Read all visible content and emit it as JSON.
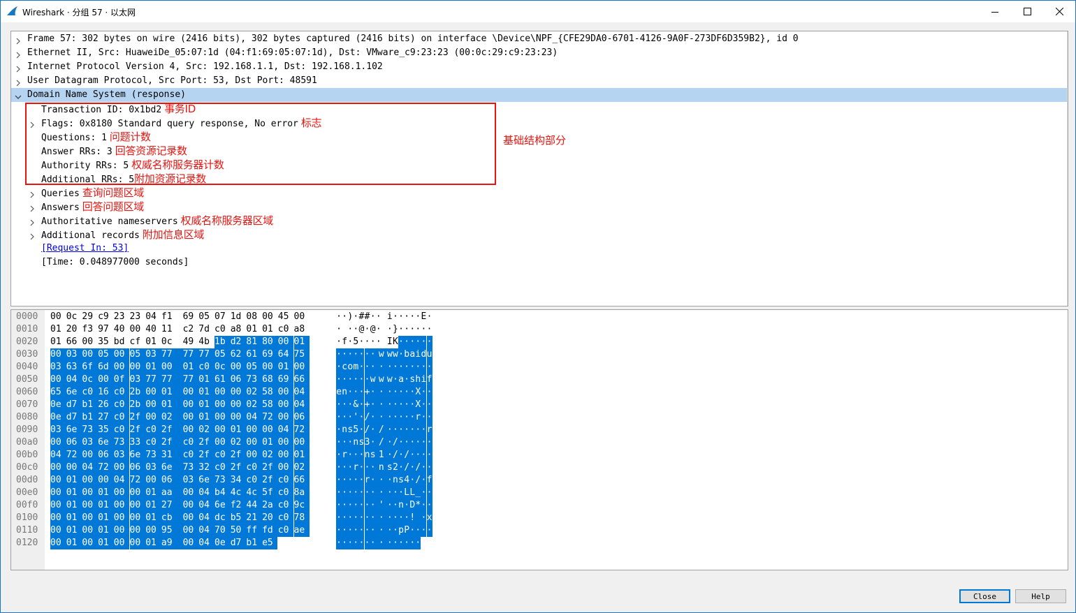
{
  "window": {
    "title": "Wireshark · 分组 57 · 以太网",
    "icons": {
      "app": "wireshark-fin-icon",
      "minimize": "minimize-icon",
      "maximize": "maximize-icon",
      "close": "close-icon"
    }
  },
  "tree": {
    "frame": "Frame 57: 302 bytes on wire (2416 bits), 302 bytes captured (2416 bits) on interface \\Device\\NPF_{CFE29DA0-6701-4126-9A0F-273DF6D359B2}, id 0",
    "ethernet": "Ethernet II, Src: HuaweiDe_05:07:1d (04:f1:69:05:07:1d), Dst: VMware_c9:23:23 (00:0c:29:c9:23:23)",
    "ip": "Internet Protocol Version 4, Src: 192.168.1.1, Dst: 192.168.1.102",
    "udp": "User Datagram Protocol, Src Port: 53, Dst Port: 48591",
    "dns": "Domain Name System (response)",
    "transaction_id": "Transaction ID: 0x1bd2",
    "transaction_id_note": "事务ID",
    "flags": "Flags: 0x8180 Standard query response, No error",
    "flags_note": "标志",
    "questions": "Questions: 1",
    "questions_note": "问题计数",
    "answer_rrs": "Answer RRs: 3",
    "answer_rrs_note": "回答资源记录数",
    "authority_rrs": "Authority RRs: 5",
    "authority_rrs_note": "权威名称服务器计数",
    "additional_rrs": "Additional RRs: 5",
    "additional_rrs_note": "附加资源记录数",
    "queries": "Queries",
    "queries_note": "查询问题区域",
    "answers": "Answers",
    "answers_note": "回答问题区域",
    "authoritative": "Authoritative nameservers",
    "authoritative_note": "权威名称服务器区域",
    "additional": "Additional records",
    "additional_note": "附加信息区域",
    "request_in": "[Request In: 53]",
    "time": "[Time: 0.048977000 seconds]",
    "side_note": "基础结构部分"
  },
  "hex_dump": {
    "selection_start_byte": 42,
    "rows": [
      {
        "offset": "0000",
        "bytes": [
          "00",
          "0c",
          "29",
          "c9",
          "23",
          "23",
          "04",
          "f1",
          "69",
          "05",
          "07",
          "1d",
          "08",
          "00",
          "45",
          "00"
        ],
        "ascii": [
          "·",
          "·",
          ")",
          "·",
          "#",
          "#",
          "·",
          "·",
          "i",
          "·",
          "·",
          "·",
          "·",
          "·",
          "E",
          "·"
        ]
      },
      {
        "offset": "0010",
        "bytes": [
          "01",
          "20",
          "f3",
          "97",
          "40",
          "00",
          "40",
          "11",
          "c2",
          "7d",
          "c0",
          "a8",
          "01",
          "01",
          "c0",
          "a8"
        ],
        "ascii": [
          "·",
          " ",
          "·",
          "·",
          "@",
          "·",
          "@",
          "·",
          "·",
          "}",
          "·",
          "·",
          "·",
          "·",
          "·",
          "·"
        ]
      },
      {
        "offset": "0020",
        "bytes": [
          "01",
          "66",
          "00",
          "35",
          "bd",
          "cf",
          "01",
          "0c",
          "49",
          "4b",
          "1b",
          "d2",
          "81",
          "80",
          "00",
          "01"
        ],
        "ascii": [
          "·",
          "f",
          "·",
          "5",
          "·",
          "·",
          "·",
          "·",
          "I",
          "K",
          "·",
          "·",
          "·",
          "·",
          "·",
          "·"
        ]
      },
      {
        "offset": "0030",
        "bytes": [
          "00",
          "03",
          "00",
          "05",
          "00",
          "05",
          "03",
          "77",
          "77",
          "77",
          "05",
          "62",
          "61",
          "69",
          "64",
          "75"
        ],
        "ascii": [
          "·",
          "·",
          "·",
          "·",
          "·",
          "·",
          "·",
          "w",
          "w",
          "w",
          "·",
          "b",
          "a",
          "i",
          "d",
          "u"
        ]
      },
      {
        "offset": "0040",
        "bytes": [
          "03",
          "63",
          "6f",
          "6d",
          "00",
          "00",
          "01",
          "00",
          "01",
          "c0",
          "0c",
          "00",
          "05",
          "00",
          "01",
          "00"
        ],
        "ascii": [
          "·",
          "c",
          "o",
          "m",
          "·",
          "·",
          "·",
          "·",
          "·",
          "·",
          "·",
          "·",
          "·",
          "·",
          "·",
          "·"
        ]
      },
      {
        "offset": "0050",
        "bytes": [
          "00",
          "04",
          "0c",
          "00",
          "0f",
          "03",
          "77",
          "77",
          "77",
          "01",
          "61",
          "06",
          "73",
          "68",
          "69",
          "66"
        ],
        "ascii": [
          "·",
          "·",
          "·",
          "·",
          "·",
          "·",
          "w",
          "w",
          "w",
          "·",
          "a",
          "·",
          "s",
          "h",
          "i",
          "f"
        ]
      },
      {
        "offset": "0060",
        "bytes": [
          "65",
          "6e",
          "c0",
          "16",
          "c0",
          "2b",
          "00",
          "01",
          "00",
          "01",
          "00",
          "00",
          "02",
          "58",
          "00",
          "04"
        ],
        "ascii": [
          "e",
          "n",
          "·",
          "·",
          "·",
          "+",
          "·",
          "·",
          "·",
          "·",
          "·",
          "·",
          "·",
          "X",
          "·",
          "·"
        ]
      },
      {
        "offset": "0070",
        "bytes": [
          "0e",
          "d7",
          "b1",
          "26",
          "c0",
          "2b",
          "00",
          "01",
          "00",
          "01",
          "00",
          "00",
          "02",
          "58",
          "00",
          "04"
        ],
        "ascii": [
          "·",
          "·",
          "·",
          "&",
          "·",
          "+",
          "·",
          "·",
          "·",
          "·",
          "·",
          "·",
          "·",
          "X",
          "·",
          "·"
        ]
      },
      {
        "offset": "0080",
        "bytes": [
          "0e",
          "d7",
          "b1",
          "27",
          "c0",
          "2f",
          "00",
          "02",
          "00",
          "01",
          "00",
          "00",
          "04",
          "72",
          "00",
          "06"
        ],
        "ascii": [
          "·",
          "·",
          "·",
          "'",
          "·",
          "/",
          "·",
          "·",
          "·",
          "·",
          "·",
          "·",
          "·",
          "r",
          "·",
          "·"
        ]
      },
      {
        "offset": "0090",
        "bytes": [
          "03",
          "6e",
          "73",
          "35",
          "c0",
          "2f",
          "c0",
          "2f",
          "00",
          "02",
          "00",
          "01",
          "00",
          "00",
          "04",
          "72"
        ],
        "ascii": [
          "·",
          "n",
          "s",
          "5",
          "·",
          "/",
          "·",
          "/",
          "·",
          "·",
          "·",
          "·",
          "·",
          "·",
          "·",
          "r"
        ]
      },
      {
        "offset": "00a0",
        "bytes": [
          "00",
          "06",
          "03",
          "6e",
          "73",
          "33",
          "c0",
          "2f",
          "c0",
          "2f",
          "00",
          "02",
          "00",
          "01",
          "00",
          "00"
        ],
        "ascii": [
          "·",
          "·",
          "·",
          "n",
          "s",
          "3",
          "·",
          "/",
          "·",
          "/",
          "·",
          "·",
          "·",
          "·",
          "·",
          "·"
        ]
      },
      {
        "offset": "00b0",
        "bytes": [
          "04",
          "72",
          "00",
          "06",
          "03",
          "6e",
          "73",
          "31",
          "c0",
          "2f",
          "c0",
          "2f",
          "00",
          "02",
          "00",
          "01"
        ],
        "ascii": [
          "·",
          "r",
          "·",
          "·",
          "·",
          "n",
          "s",
          "1",
          "·",
          "/",
          "·",
          "/",
          "·",
          "·",
          "·",
          "·"
        ]
      },
      {
        "offset": "00c0",
        "bytes": [
          "00",
          "00",
          "04",
          "72",
          "00",
          "06",
          "03",
          "6e",
          "73",
          "32",
          "c0",
          "2f",
          "c0",
          "2f",
          "00",
          "02"
        ],
        "ascii": [
          "·",
          "·",
          "·",
          "r",
          "·",
          "·",
          "·",
          "n",
          "s",
          "2",
          "·",
          "/",
          "·",
          "/",
          "·",
          "·"
        ]
      },
      {
        "offset": "00d0",
        "bytes": [
          "00",
          "01",
          "00",
          "00",
          "04",
          "72",
          "00",
          "06",
          "03",
          "6e",
          "73",
          "34",
          "c0",
          "2f",
          "c0",
          "66"
        ],
        "ascii": [
          "·",
          "·",
          "·",
          "·",
          "·",
          "r",
          "·",
          "·",
          "·",
          "n",
          "s",
          "4",
          "·",
          "/",
          "·",
          "f"
        ]
      },
      {
        "offset": "00e0",
        "bytes": [
          "00",
          "01",
          "00",
          "01",
          "00",
          "00",
          "01",
          "aa",
          "00",
          "04",
          "b4",
          "4c",
          "4c",
          "5f",
          "c0",
          "8a"
        ],
        "ascii": [
          "·",
          "·",
          "·",
          "·",
          "·",
          "·",
          "·",
          "·",
          "·",
          "·",
          "·",
          "L",
          "L",
          "_",
          "·",
          "·"
        ]
      },
      {
        "offset": "00f0",
        "bytes": [
          "00",
          "01",
          "00",
          "01",
          "00",
          "00",
          "01",
          "27",
          "00",
          "04",
          "6e",
          "f2",
          "44",
          "2a",
          "c0",
          "9c"
        ],
        "ascii": [
          "·",
          "·",
          "·",
          "·",
          "·",
          "·",
          "·",
          "'",
          "·",
          "·",
          "n",
          "·",
          "D",
          "*",
          "·",
          "·"
        ]
      },
      {
        "offset": "0100",
        "bytes": [
          "00",
          "01",
          "00",
          "01",
          "00",
          "00",
          "01",
          "cb",
          "00",
          "04",
          "dc",
          "b5",
          "21",
          "20",
          "c0",
          "78"
        ],
        "ascii": [
          "·",
          "·",
          "·",
          "·",
          "·",
          "·",
          "·",
          "·",
          "·",
          "·",
          "·",
          "·",
          "!",
          " ",
          "·",
          "x"
        ]
      },
      {
        "offset": "0110",
        "bytes": [
          "00",
          "01",
          "00",
          "01",
          "00",
          "00",
          "00",
          "95",
          "00",
          "04",
          "70",
          "50",
          "ff",
          "fd",
          "c0",
          "ae"
        ],
        "ascii": [
          "·",
          "·",
          "·",
          "·",
          "·",
          "·",
          "·",
          "·",
          "·",
          "·",
          "p",
          "P",
          "·",
          "·",
          "·",
          "·"
        ]
      },
      {
        "offset": "0120",
        "bytes": [
          "00",
          "01",
          "00",
          "01",
          "00",
          "00",
          "01",
          "a9",
          "00",
          "04",
          "0e",
          "d7",
          "b1",
          "e5"
        ],
        "ascii": [
          "·",
          "·",
          "·",
          "·",
          "·",
          "·",
          "·",
          "·",
          "·",
          "·",
          "·",
          "·",
          "·",
          "·"
        ]
      }
    ]
  },
  "buttons": {
    "close": "Close",
    "help": "Help"
  },
  "colors": {
    "selection": "#0078d7",
    "tree_selected": "#b5d4f2",
    "annotation": "#e8140f"
  }
}
